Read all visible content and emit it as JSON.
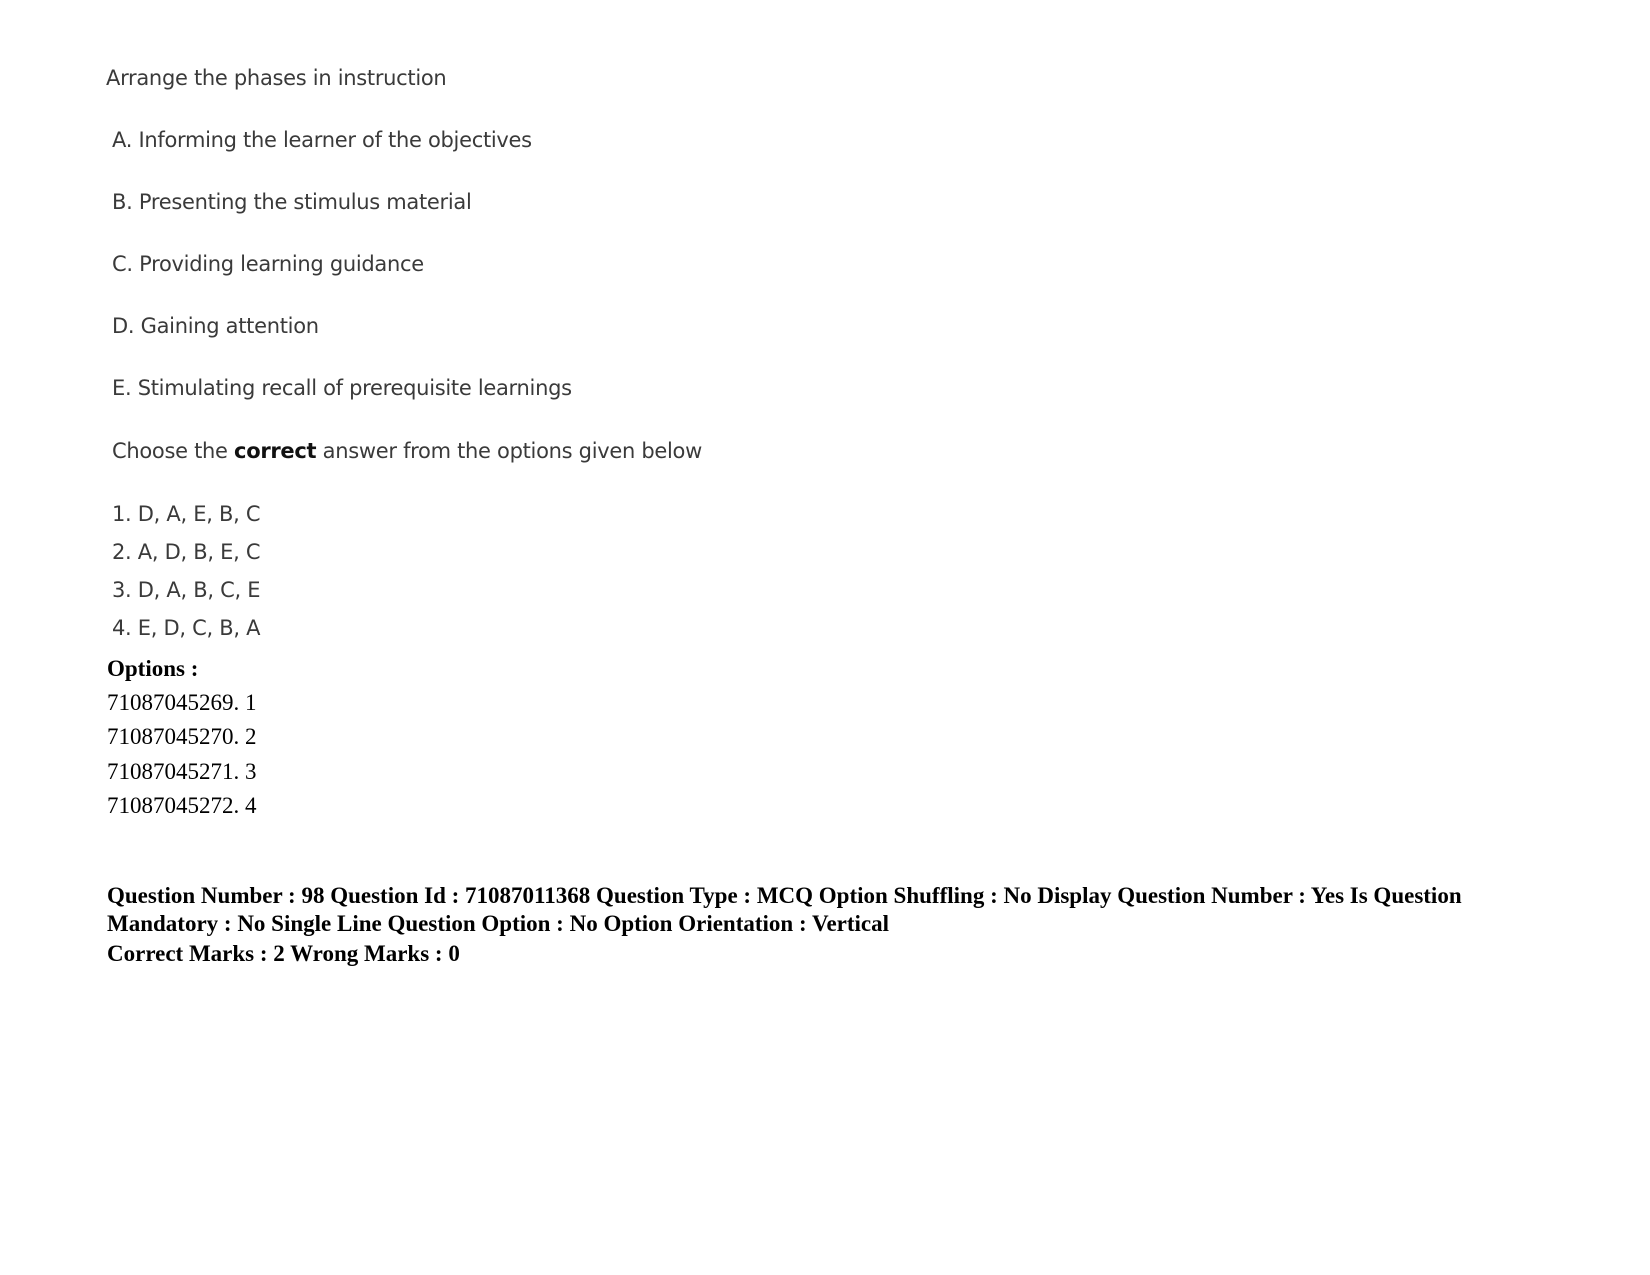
{
  "question": {
    "prompt": "Arrange the phases in instruction",
    "statements": [
      "A. Informing the learner of the objectives",
      "B. Presenting the stimulus material",
      "C. Providing learning guidance",
      "D. Gaining attention",
      "E. Stimulating recall of prerequisite learnings"
    ],
    "instruction_prefix": "Choose the ",
    "instruction_bold": "correct",
    "instruction_suffix": " answer from the options given below",
    "choices": [
      "1. D, A, E, B, C",
      "2. A, D, B, E, C",
      "3. D, A, B, C, E",
      "4. E, D, C, B, A"
    ]
  },
  "options": {
    "heading": "Options :",
    "items": [
      "71087045269. 1",
      "71087045270. 2",
      "71087045271. 3",
      "71087045272. 4"
    ]
  },
  "metadata": {
    "line1": "Question Number : 98 Question Id : 71087011368 Question Type : MCQ Option Shuffling : No Display Question Number : Yes Is Question Mandatory : No Single Line Question Option : No Option Orientation : Vertical",
    "marks": "Correct Marks : 2 Wrong Marks : 0"
  }
}
